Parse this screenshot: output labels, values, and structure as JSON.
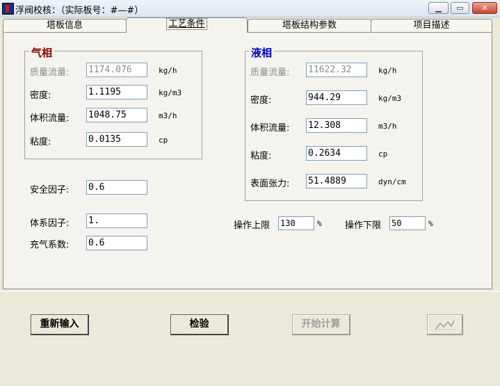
{
  "window": {
    "title": "浮阀校核：（实际板号：#—#）",
    "min_icon": "minimize-icon",
    "max_icon": "maximize-icon",
    "close_icon": "close-icon"
  },
  "tabs": [
    {
      "label": "塔板信息",
      "active": false
    },
    {
      "label": "工艺条件",
      "active": true
    },
    {
      "label": "塔板结构参数",
      "active": false
    },
    {
      "label": "项目描述",
      "active": false
    }
  ],
  "gas": {
    "title": "气相",
    "title_color": "#8b0000",
    "mass_flow": {
      "label": "质量流量:",
      "value": "1174.076",
      "unit": "kg/h"
    },
    "density": {
      "label": "密度:",
      "value": "1.1195",
      "unit": "kg/m3"
    },
    "vol_flow": {
      "label": "体积流量:",
      "value": "1048.75",
      "unit": "m3/h"
    },
    "viscosity": {
      "label": "粘度:",
      "value": "0.0135",
      "unit": "cp"
    }
  },
  "liquid": {
    "title": "液相",
    "title_color": "#0000c0",
    "mass_flow": {
      "label": "质量流量:",
      "value": "11622.32",
      "unit": "kg/h"
    },
    "density": {
      "label": "密度:",
      "value": "944.29",
      "unit": "kg/m3"
    },
    "vol_flow": {
      "label": "体积流量:",
      "value": "12.308",
      "unit": "m3/h"
    },
    "viscosity": {
      "label": "粘度:",
      "value": "0.2634",
      "unit": "cp"
    },
    "surface_tension": {
      "label": "表面张力:",
      "value": "51.4889",
      "unit": "dyn/cm"
    }
  },
  "factors": {
    "safety": {
      "label": "安全因子:",
      "value": "0.6"
    },
    "system": {
      "label": "体系因子:",
      "value": "1."
    },
    "aeration": {
      "label": "充气系数:",
      "value": "0.6"
    }
  },
  "operation": {
    "upper": {
      "label": "操作上限",
      "value": "130",
      "unit": "%"
    },
    "lower": {
      "label": "操作下限",
      "value": "50",
      "unit": "%"
    }
  },
  "buttons": {
    "reset": "重新输入",
    "check": "检验",
    "start": "开始计算",
    "chart_icon": "line-chart-icon"
  }
}
